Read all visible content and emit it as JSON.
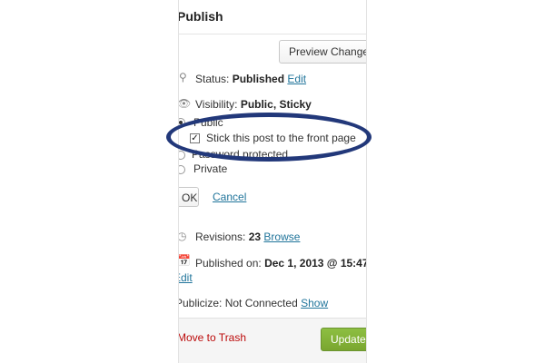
{
  "publish": {
    "title": "Publish",
    "preview_label": "Preview Changes",
    "status_label": "Status:",
    "status_value": "Published",
    "status_edit": "Edit",
    "visibility_label": "Visibility:",
    "visibility_value": "Public, Sticky",
    "options": {
      "public": "Public",
      "sticky": "Stick this post to the front page",
      "password": "Password protected",
      "private": "Private"
    },
    "ok_label": "OK",
    "cancel_label": "Cancel",
    "revisions_label": "Revisions:",
    "revisions_count": "23",
    "revisions_browse": "Browse",
    "published_on_label": "Published on:",
    "published_on_value": "Dec 1, 2013 @ 15:47",
    "published_edit": "Edit",
    "publicize_label": "Publicize: Not Connected",
    "publicize_show": "Show",
    "trash_label": "Move to Trash",
    "update_label": "Update"
  },
  "icons": {
    "status": "pin-icon",
    "visibility": "eye-icon",
    "revisions": "history-icon",
    "published": "calendar-icon"
  },
  "colors": {
    "link": "#21759b",
    "trash": "#bc0b0b",
    "update_button": "#7aa62f",
    "highlight_ellipse": "#22387a"
  }
}
